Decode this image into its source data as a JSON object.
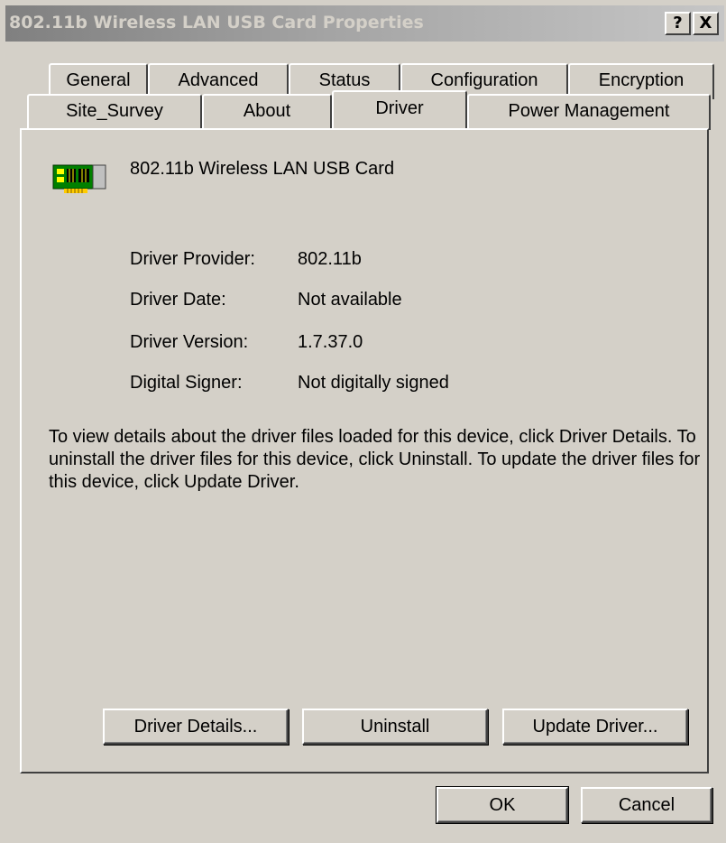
{
  "window": {
    "title": "802.11b Wireless LAN USB Card Properties",
    "help_button": "?",
    "close_button": "X"
  },
  "tabs_row_back": [
    {
      "label": "General"
    },
    {
      "label": "Advanced"
    },
    {
      "label": "Status"
    },
    {
      "label": "Configuration"
    },
    {
      "label": "Encryption"
    }
  ],
  "tabs_row_front": [
    {
      "label": "Site_Survey"
    },
    {
      "label": "About"
    },
    {
      "label": "Driver",
      "active": true
    },
    {
      "label": "Power Management"
    }
  ],
  "device": {
    "icon": "network-card-icon",
    "name": "802.11b Wireless LAN USB Card"
  },
  "driver_info": [
    {
      "label": "Driver Provider:",
      "value": "802.11b"
    },
    {
      "label": "Driver Date:",
      "value": "Not available"
    },
    {
      "label": "Driver Version:",
      "value": "1.7.37.0"
    },
    {
      "label": "Digital Signer:",
      "value": "Not digitally signed"
    }
  ],
  "description": "To view details about the driver files loaded for this device, click Driver Details. To uninstall the driver files for this device, click Uninstall. To update the driver files for this device, click Update Driver.",
  "panel_buttons": {
    "details": "Driver Details...",
    "uninstall": "Uninstall",
    "update": "Update Driver..."
  },
  "dialog_buttons": {
    "ok": "OK",
    "cancel": "Cancel"
  },
  "colors": {
    "face": "#d4d0c8",
    "title_inactive_start": "#808080",
    "title_inactive_end": "#c6c6c6"
  }
}
